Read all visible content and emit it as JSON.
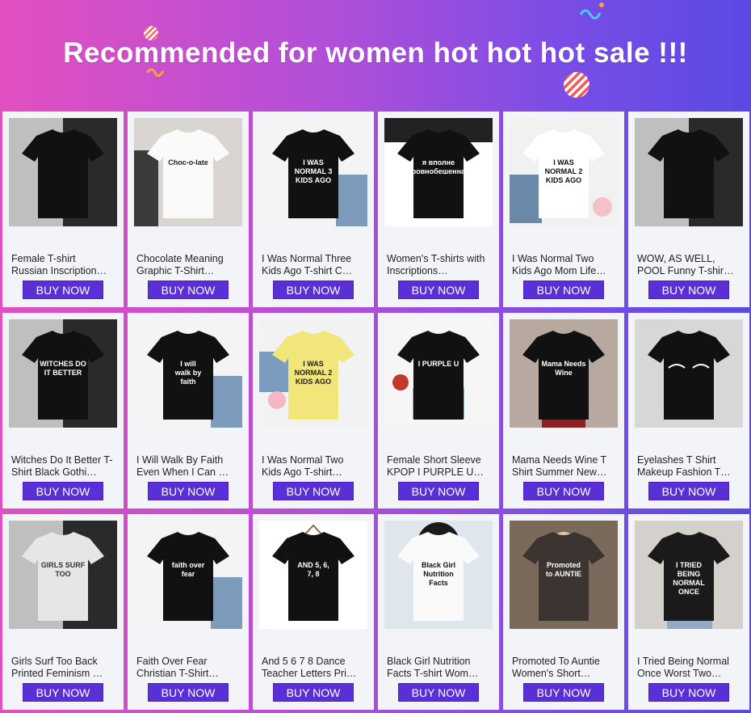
{
  "banner": {
    "title": "Recommended for women hot hot hot sale !!!"
  },
  "products": [
    {
      "title": "Female T-shirt Russian Inscription…",
      "button": "BUY NOW",
      "shirt_text": "",
      "scene": "photo-dark"
    },
    {
      "title": "Chocolate Meaning Graphic T-Shirt…",
      "button": "BUY NOW",
      "shirt_text": "Choc-o-late",
      "scene": "white-shirt-dark"
    },
    {
      "title": "I Was Normal Three Kids Ago T-shirt C…",
      "button": "BUY NOW",
      "shirt_text": "I WAS NORMAL 3 KIDS AGO",
      "scene": "black-flatlay"
    },
    {
      "title": "Women's T-shirts with Inscriptions…",
      "button": "BUY NOW",
      "shirt_text": "я вполне уровнобешенная",
      "scene": "black-pattern"
    },
    {
      "title": "I Was Normal Two Kids Ago Mom Life…",
      "button": "BUY NOW",
      "shirt_text": "I WAS NORMAL 2 KIDS AGO",
      "scene": "white-flatlay"
    },
    {
      "title": "WOW, AS WELL, POOL Funny T-shir…",
      "button": "BUY NOW",
      "shirt_text": "",
      "scene": "photo-collage"
    },
    {
      "title": "Witches Do It Better T-Shirt Black Gothi…",
      "button": "BUY NOW",
      "shirt_text": "WITCHES DO IT BETTER",
      "scene": "model-dark"
    },
    {
      "title": "I Will Walk By Faith Even When I Can …",
      "button": "BUY NOW",
      "shirt_text": "I will walk by faith",
      "scene": "black-flatlay"
    },
    {
      "title": "I Was Normal Two Kids Ago T-shirt…",
      "button": "BUY NOW",
      "shirt_text": "I WAS NORMAL 2 KIDS AGO",
      "scene": "yellow-flatlay"
    },
    {
      "title": "Female Short Sleeve KPOP I PURPLE U…",
      "button": "BUY NOW",
      "shirt_text": "I PURPLE U",
      "scene": "grid-flatlay"
    },
    {
      "title": "Mama Needs Wine T Shirt Summer New…",
      "button": "BUY NOW",
      "shirt_text": "Mama Needs Wine",
      "scene": "model-red"
    },
    {
      "title": "Eyelashes T Shirt Makeup Fashion T…",
      "button": "BUY NOW",
      "shirt_text": "",
      "scene": "eyelash"
    },
    {
      "title": "Girls Surf Too Back Printed Feminism …",
      "button": "BUY NOW",
      "shirt_text": "GIRLS SURF TOO",
      "scene": "back-bw"
    },
    {
      "title": "Faith Over Fear Christian T-Shirt…",
      "button": "BUY NOW",
      "shirt_text": "faith over fear",
      "scene": "black-flatlay"
    },
    {
      "title": "And 5 6 7 8 Dance Teacher Letters Pri…",
      "button": "BUY NOW",
      "shirt_text": "AND 5, 6, 7, 8",
      "scene": "hanger"
    },
    {
      "title": "Black Girl Nutrition Facts T-shirt Wom…",
      "button": "BUY NOW",
      "shirt_text": "Black Girl Nutrition Facts",
      "scene": "model-white"
    },
    {
      "title": "Promoted To Auntie Women's Short…",
      "button": "BUY NOW",
      "shirt_text": "Promoted to AUNTIE",
      "scene": "model-street"
    },
    {
      "title": "I Tried Being Normal Once Worst Two…",
      "button": "BUY NOW",
      "shirt_text": "I TRIED BEING NORMAL ONCE",
      "scene": "model-crop"
    }
  ]
}
